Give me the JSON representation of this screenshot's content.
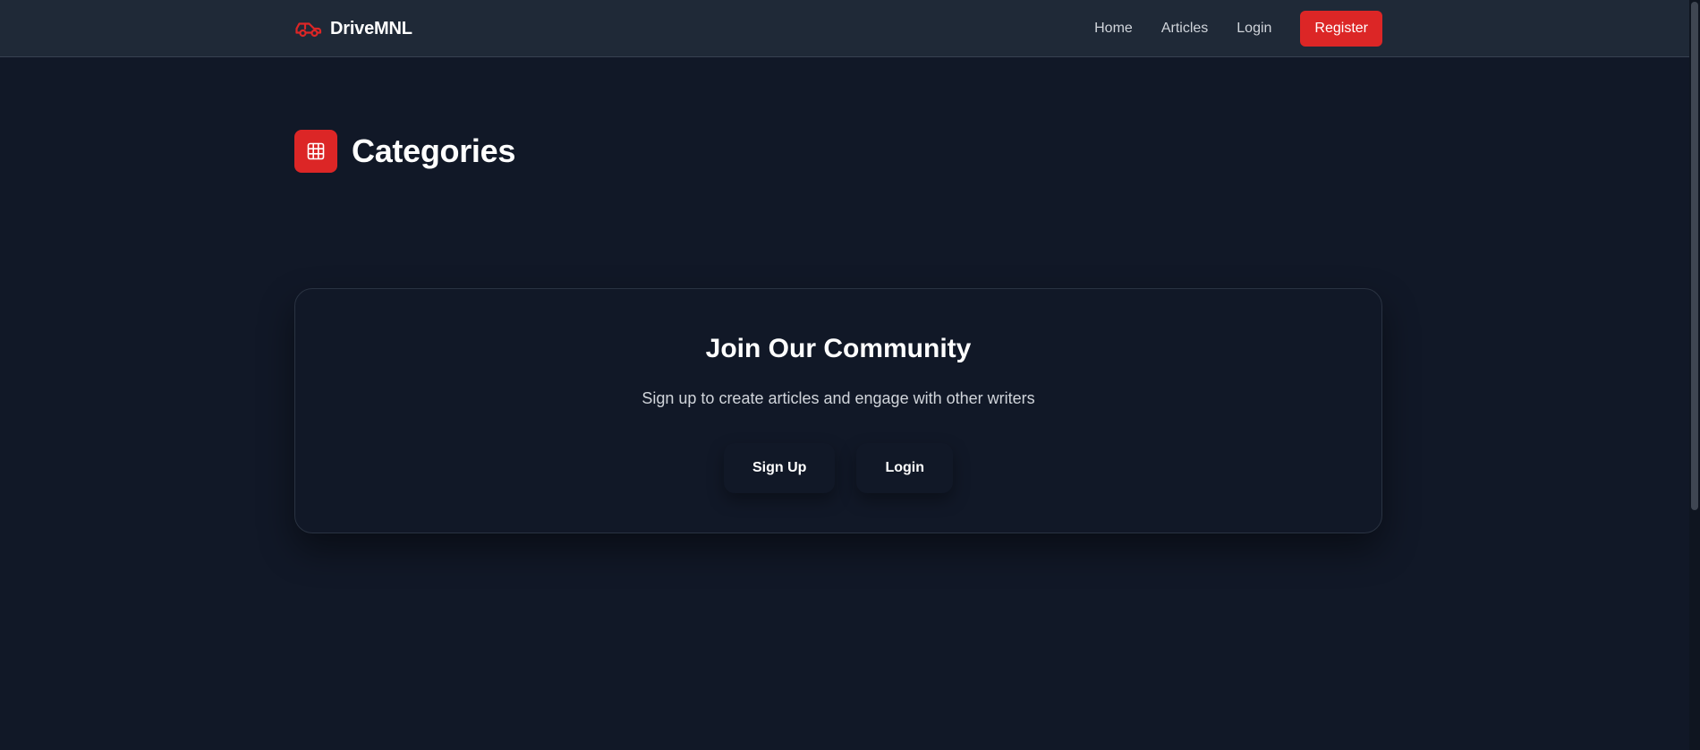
{
  "brand": {
    "name": "DriveMNL",
    "icon": "car-icon",
    "accent_color": "#dc2626"
  },
  "nav": {
    "links": [
      {
        "label": "Home"
      },
      {
        "label": "Articles"
      },
      {
        "label": "Login"
      }
    ],
    "register_label": "Register"
  },
  "page": {
    "title": "Categories",
    "icon": "grid-icon"
  },
  "community": {
    "title": "Join Our Community",
    "subtitle": "Sign up to create articles and engage with other writers",
    "signup_label": "Sign Up",
    "login_label": "Login"
  },
  "colors": {
    "background": "#111827",
    "navbar": "#1f2937",
    "accent": "#dc2626",
    "muted_text": "#d1d5db"
  }
}
